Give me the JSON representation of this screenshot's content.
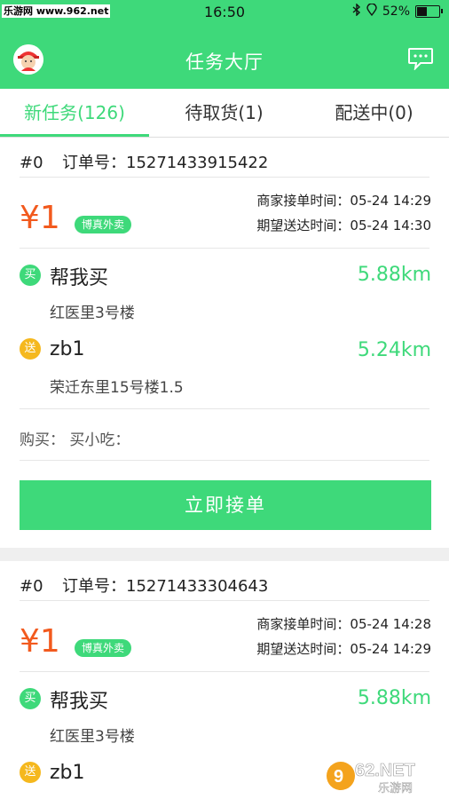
{
  "status_bar": {
    "watermark": "乐游网 www.962.net",
    "time": "16:50",
    "battery": "52%",
    "battery_level": 0.52
  },
  "nav": {
    "title": "任务大厅",
    "avatar_icon": "user-avatar",
    "message_icon": "chat-bubble-icon"
  },
  "tabs": [
    {
      "label": "新任务(126)",
      "active": true
    },
    {
      "label": "待取货(1)",
      "active": false
    },
    {
      "label": "配送中(0)",
      "active": false
    }
  ],
  "orders": [
    {
      "index": "#0",
      "order_label": "订单号：",
      "order_no": "15271433915422",
      "price": "¥1",
      "badge": "博真外卖",
      "merchant_time_label": "商家接单时间：",
      "merchant_time": "05-24 14:29",
      "expect_time_label": "期望送达时间：",
      "expect_time": "05-24 14:30",
      "buy_icon": "买",
      "buy_name": "帮我买",
      "buy_addr": "红医里3号楼",
      "buy_dist": "5.88km",
      "send_icon": "送",
      "send_name": "zb1",
      "send_addr": "荣迁东里15号楼1.5",
      "send_dist": "5.24km",
      "purchase": "购买：  买小吃：",
      "button": "立即接单"
    },
    {
      "index": "#0",
      "order_label": "订单号：",
      "order_no": "15271433304643",
      "price": "¥1",
      "badge": "博真外卖",
      "merchant_time_label": "商家接单时间：",
      "merchant_time": "05-24 14:28",
      "expect_time_label": "期望送达时间：",
      "expect_time": "05-24 14:29",
      "buy_icon": "买",
      "buy_name": "帮我买",
      "buy_addr": "红医里3号楼",
      "buy_dist": "5.88km",
      "send_icon": "送",
      "send_name": "zb1"
    }
  ],
  "corner_logo": "962.NET 乐游网",
  "colors": {
    "accent": "#3ed97a",
    "price": "#f25a1e",
    "send": "#f5b81e"
  }
}
